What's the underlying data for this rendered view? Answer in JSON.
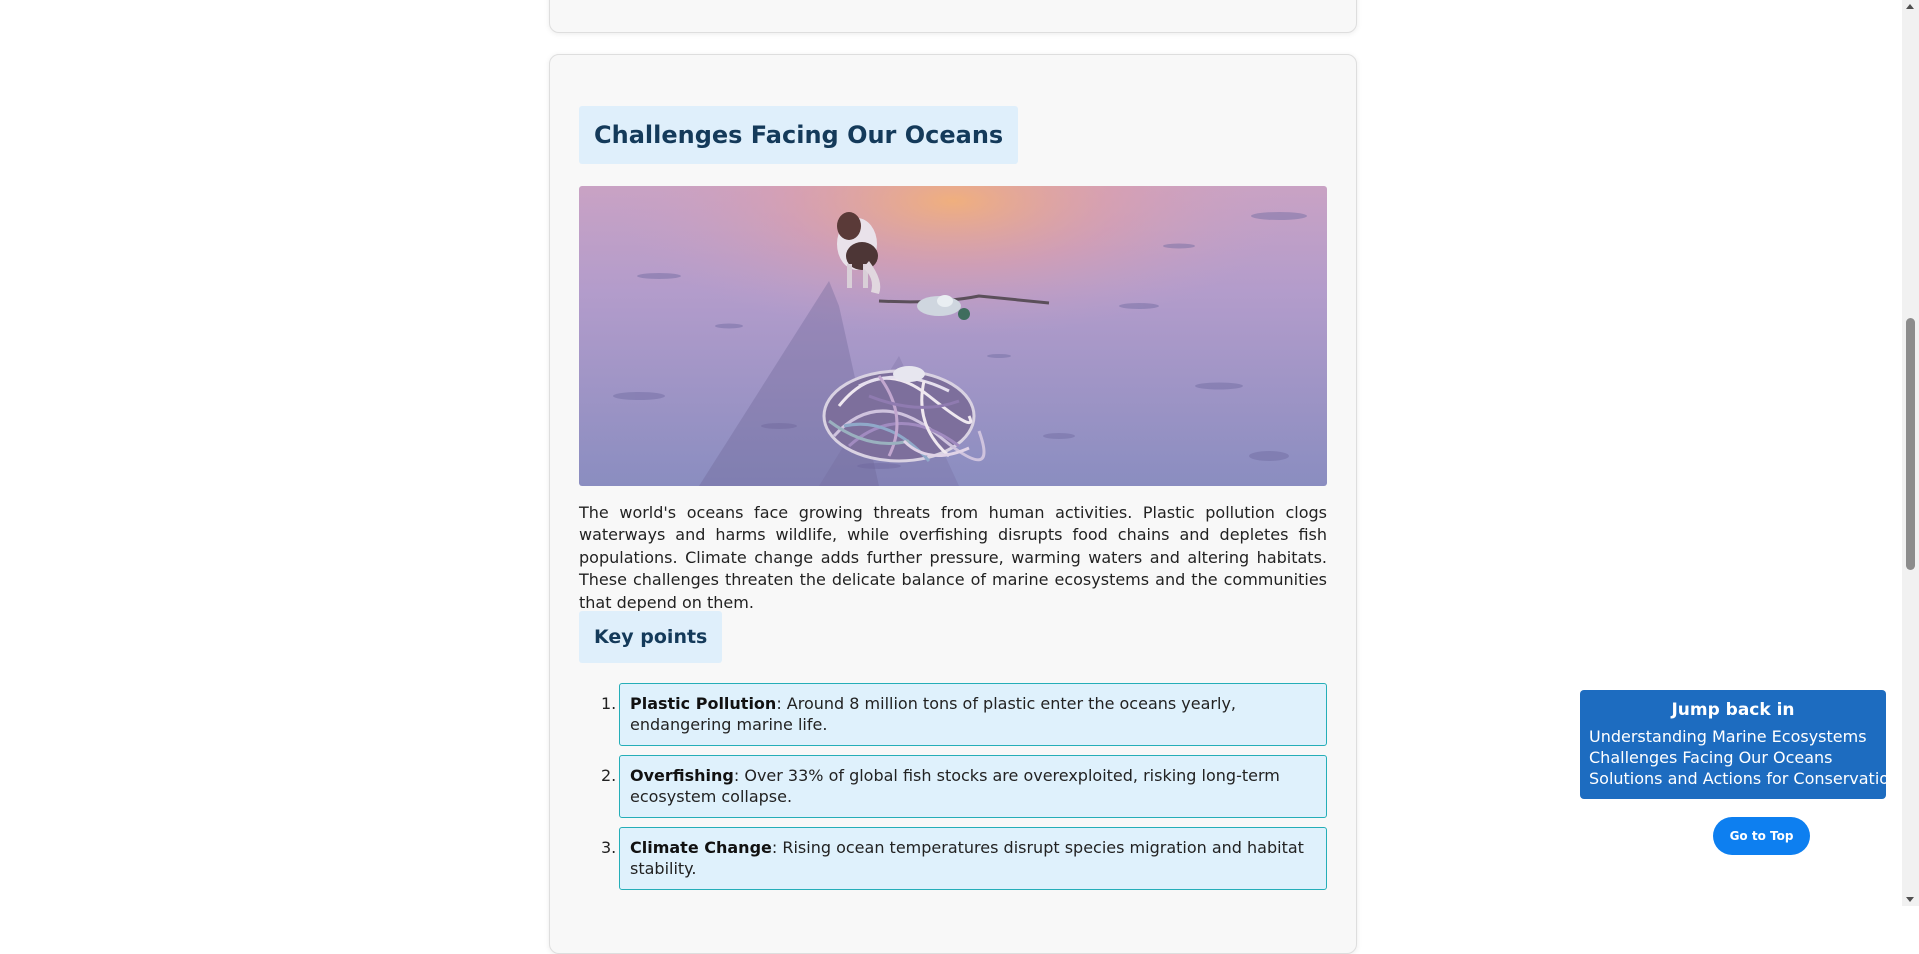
{
  "section": {
    "title": "Challenges Facing Our Oceans",
    "body": "The world's oceans face growing threats from human activities. Plastic pollution clogs waterways and harms wildlife, while overfishing disrupts food chains and depletes fish populations. Climate change adds further pressure, warming waters and altering habitats. These challenges threaten the delicate balance of marine ecosystems and the communities that depend on them.",
    "key_points_title": "Key points",
    "key_points": [
      {
        "num": "1.",
        "term": "Plastic Pollution",
        "text": ": Around 8 million tons of plastic enter the oceans yearly, endangering marine life."
      },
      {
        "num": "2.",
        "term": "Overfishing",
        "text": ": Over 33% of global fish stocks are overexploited, risking long-term ecosystem collapse."
      },
      {
        "num": "3.",
        "term": "Climate Change",
        "text": ": Rising ocean temperatures disrupt species migration and habitat stability."
      }
    ]
  },
  "jump": {
    "title": "Jump back in",
    "links": [
      "Understanding Marine Ecosystems",
      "Challenges Facing Our Oceans",
      "Solutions and Actions for Conservation"
    ]
  },
  "go_top_label": "Go to Top",
  "colors": {
    "heading_bg": "#dfeffb",
    "heading_text": "#143a5a",
    "key_box_bg": "#dff1fc",
    "key_box_border": "#25aeb8",
    "jump_bg": "#1d6cc0",
    "go_top_bg": "#0d7ff0"
  }
}
